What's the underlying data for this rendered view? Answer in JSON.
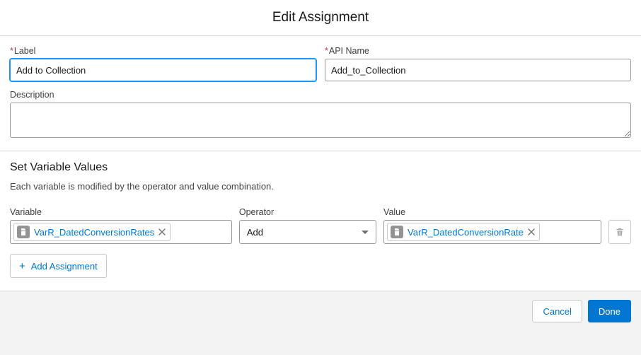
{
  "header": {
    "title": "Edit Assignment"
  },
  "fields": {
    "label_label": "Label",
    "label_value": "Add to Collection",
    "api_name_label": "API Name",
    "api_name_value": "Add_to_Collection",
    "description_label": "Description",
    "description_value": ""
  },
  "set_section": {
    "heading": "Set Variable Values",
    "help": "Each variable is modified by the operator and value combination.",
    "columns": {
      "variable": "Variable",
      "operator": "Operator",
      "value": "Value"
    },
    "row": {
      "variable_pill": "VarR_DatedConversionRates",
      "operator_selected": "Add",
      "value_pill": "VarR_DatedConversionRate"
    },
    "add_label": "Add Assignment"
  },
  "footer": {
    "cancel": "Cancel",
    "done": "Done"
  }
}
